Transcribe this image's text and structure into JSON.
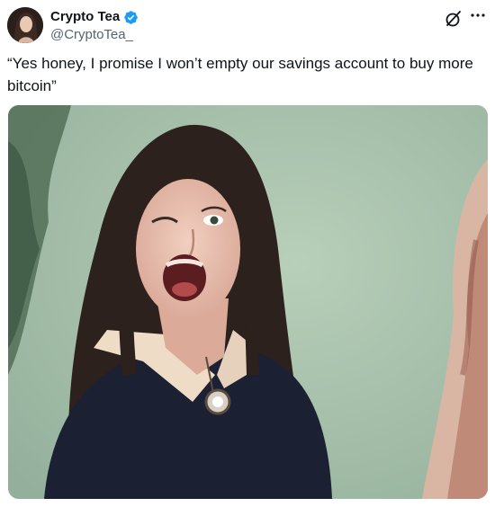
{
  "tweet": {
    "display_name": "Crypto Tea",
    "handle": "@CryptoTea_",
    "verified": true,
    "text": "“Yes honey, I promise I won’t empty our savings account to buy more bitcoin”",
    "icons": {
      "verified": "verified-badge-icon",
      "grok": "grok-icon",
      "more": "more-options-icon"
    },
    "colors": {
      "verified_blue": "#1d9bf0",
      "secondary_text": "#536471",
      "primary_text": "#0f1419"
    }
  }
}
